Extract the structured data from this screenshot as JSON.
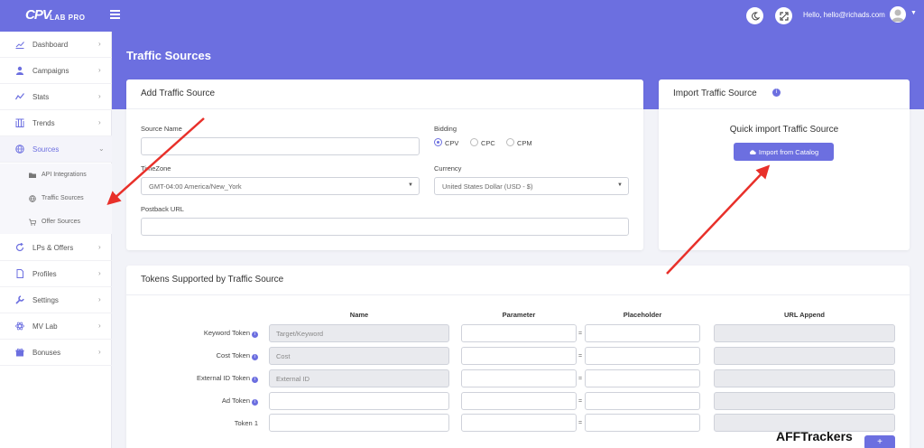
{
  "app": {
    "logo_main": "CPV",
    "logo_sub": "LAB PRO",
    "greeting": "Hello, hello@richads.com",
    "accent_color": "#6c6fe0"
  },
  "header_icons": [
    "hamburger-icon",
    "moon-icon",
    "expand-icon",
    "user-avatar-icon"
  ],
  "sidebar": {
    "items": [
      {
        "label": "Dashboard",
        "icon": "chart-line-icon"
      },
      {
        "label": "Campaigns",
        "icon": "user-tie-icon"
      },
      {
        "label": "Stats",
        "icon": "stats-icon"
      },
      {
        "label": "Trends",
        "icon": "columns-icon"
      },
      {
        "label": "Sources",
        "icon": "globe-icon"
      },
      {
        "label": "LPs & Offers",
        "icon": "refresh-icon"
      },
      {
        "label": "Profiles",
        "icon": "file-icon"
      },
      {
        "label": "Settings",
        "icon": "wrench-icon"
      },
      {
        "label": "MV Lab",
        "icon": "atom-icon"
      },
      {
        "label": "Bonuses",
        "icon": "gift-icon"
      }
    ],
    "sources_sub": [
      {
        "label": "API Integrations",
        "icon": "folder-icon"
      },
      {
        "label": "Traffic Sources",
        "icon": "globe-icon"
      },
      {
        "label": "Offer Sources",
        "icon": "cart-icon"
      }
    ]
  },
  "page": {
    "title": "Traffic Sources"
  },
  "add_source": {
    "title": "Add Traffic Source",
    "source_name_label": "Source Name",
    "source_name_value": "",
    "bidding_label": "Bidding",
    "bidding_options": [
      "CPV",
      "CPC",
      "CPM"
    ],
    "bidding_selected": "CPV",
    "timezone_label": "TimeZone",
    "timezone_value": "GMT-04:00 America/New_York",
    "currency_label": "Currency",
    "currency_value": "United States Dollar (USD - $)",
    "postback_label": "Postback URL",
    "postback_value": ""
  },
  "import_source": {
    "title": "Import Traffic Source",
    "subtitle": "Quick import Traffic Source",
    "button_label": "Import from Catalog"
  },
  "tokens": {
    "title": "Tokens Supported by Traffic Source",
    "columns": [
      "Name",
      "Parameter",
      "Placeholder",
      "URL Append"
    ],
    "rows": [
      {
        "label": "Keyword Token",
        "info": true,
        "name_placeholder": "Target/Keyword",
        "name_disabled": true
      },
      {
        "label": "Cost Token",
        "info": true,
        "name_placeholder": "Cost",
        "name_disabled": true
      },
      {
        "label": "External ID Token",
        "info": true,
        "name_placeholder": "External ID",
        "name_disabled": true
      },
      {
        "label": "Ad Token",
        "info": true,
        "name_placeholder": "",
        "name_disabled": false
      },
      {
        "label": "Token 1",
        "info": false,
        "name_placeholder": "",
        "name_disabled": false
      }
    ],
    "equals_sign": "=",
    "add_button": "+"
  },
  "watermark": "AFFTrackers"
}
